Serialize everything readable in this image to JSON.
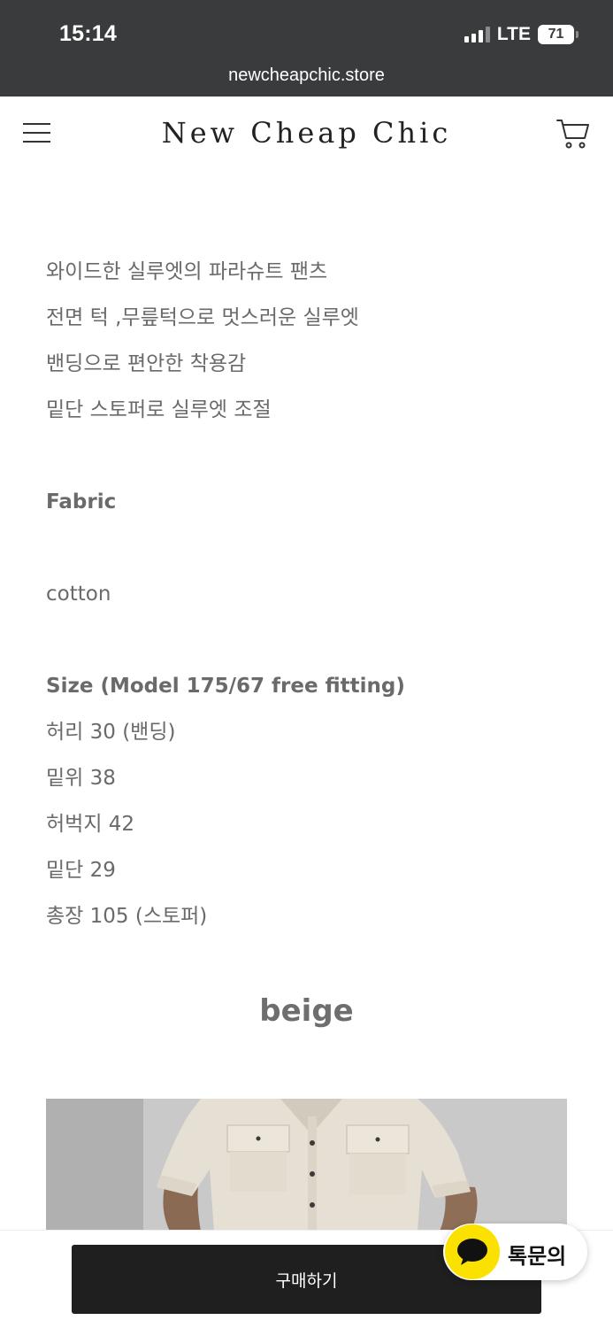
{
  "status_bar": {
    "time": "15:14",
    "network": "LTE",
    "battery": "71"
  },
  "browser": {
    "url": "newcheapchic.store"
  },
  "header": {
    "logo": "New Cheap Chic",
    "menu_icon": "hamburger-menu-icon",
    "cart_icon": "shopping-cart-icon"
  },
  "description": {
    "lines": [
      "와이드한 실루엣의 파라슈트 팬츠",
      "전면 턱 ,무릎턱으로 멋스러운 실루엣",
      "밴딩으로 편안한 착용감",
      "밑단 스토퍼로 실루엣 조절"
    ]
  },
  "fabric": {
    "heading": "Fabric",
    "value": "cotton"
  },
  "size": {
    "heading": "Size (Model 175/67  free  fitting)",
    "rows": [
      "허리  30 (밴딩)",
      "밑위  38",
      "허벅지  42",
      "밑단 29",
      "총장 105 (스토퍼)"
    ]
  },
  "color_title": "beige",
  "buy_button": {
    "label": "구매하기"
  },
  "chat_button": {
    "label": "톡문의",
    "icon": "kakao-talk-icon",
    "accent": "#fae100"
  },
  "colors": {
    "status_bar_bg": "#3a3b3c",
    "button_bg": "#1f1f1f",
    "text": "#6a6a6a"
  }
}
